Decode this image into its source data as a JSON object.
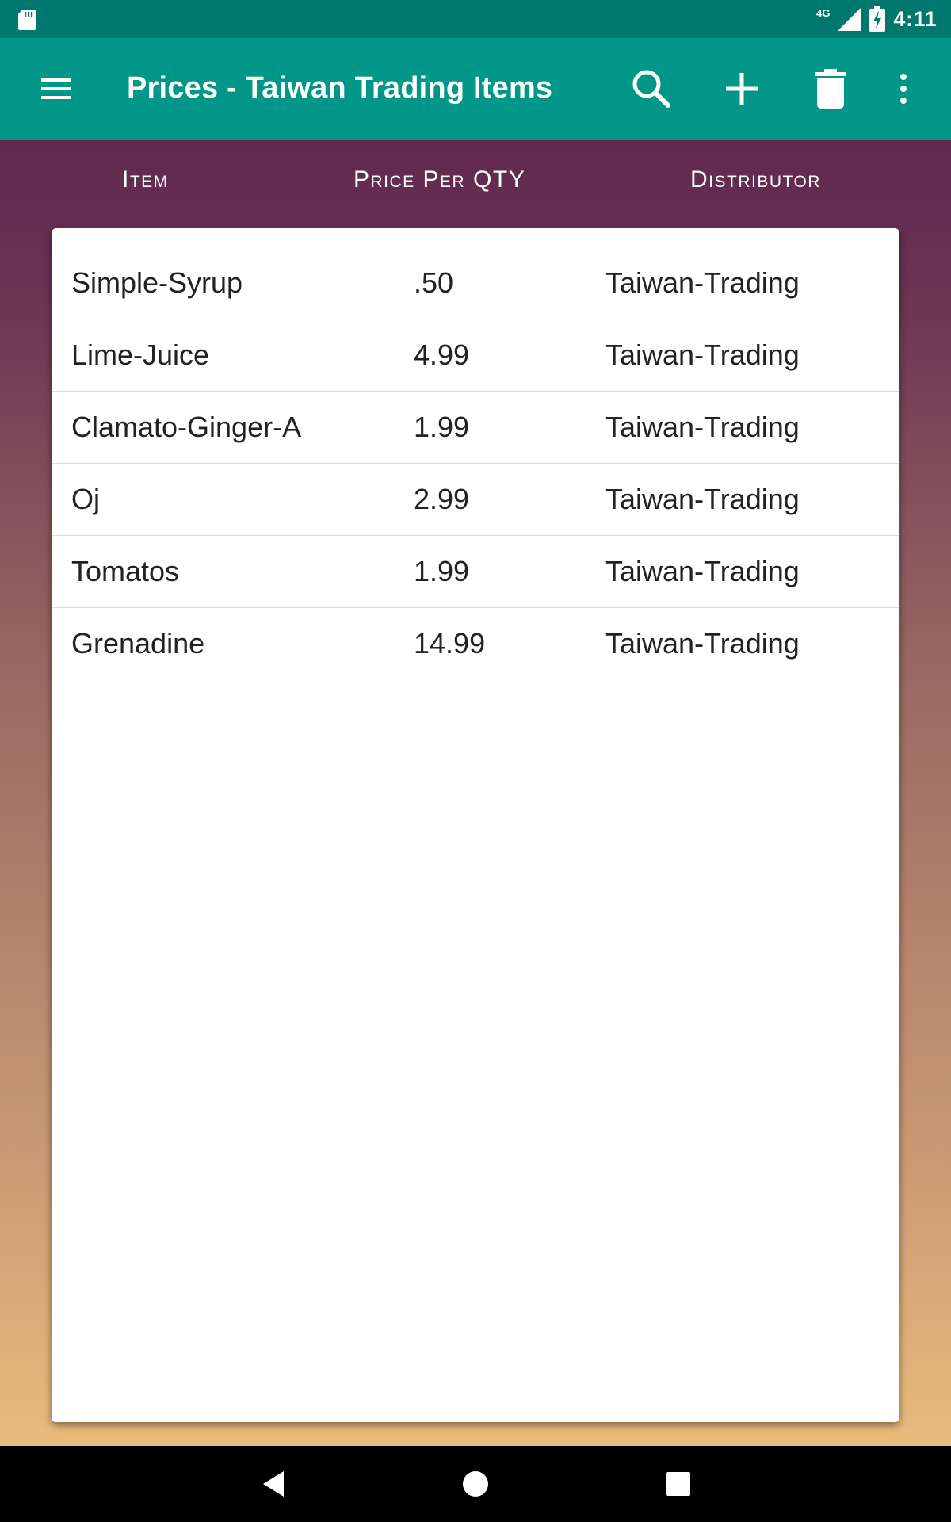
{
  "status_bar": {
    "network": "4G",
    "time": "4:11",
    "icons": [
      "sd-card-icon",
      "signal-icon",
      "battery-charging-icon"
    ]
  },
  "app_bar": {
    "title": "Prices - Taiwan Trading Items",
    "background": "#009688",
    "icons": [
      "menu-icon",
      "search-icon",
      "add-icon",
      "delete-icon",
      "more-vert-icon"
    ]
  },
  "table": {
    "headers": {
      "item": "Item",
      "price": "Price Per QTY",
      "distributor": "Distributor"
    },
    "rows": [
      {
        "item": "Simple-Syrup",
        "price": ".50",
        "distributor": "Taiwan-Trading"
      },
      {
        "item": "Lime-Juice",
        "price": "4.99",
        "distributor": "Taiwan-Trading"
      },
      {
        "item": "Clamato-Ginger-A",
        "price": "1.99",
        "distributor": "Taiwan-Trading"
      },
      {
        "item": "Oj",
        "price": "2.99",
        "distributor": "Taiwan-Trading"
      },
      {
        "item": "Tomatos",
        "price": "1.99",
        "distributor": "Taiwan-Trading"
      },
      {
        "item": "Grenadine",
        "price": "14.99",
        "distributor": "Taiwan-Trading"
      }
    ]
  },
  "nav_bar": {
    "icons": [
      "back-icon",
      "home-icon",
      "recents-icon"
    ]
  },
  "colors": {
    "status_bar": "#00786d",
    "app_bar": "#009688",
    "gradient_top": "#57204c",
    "gradient_bottom": "#f2c47f"
  }
}
